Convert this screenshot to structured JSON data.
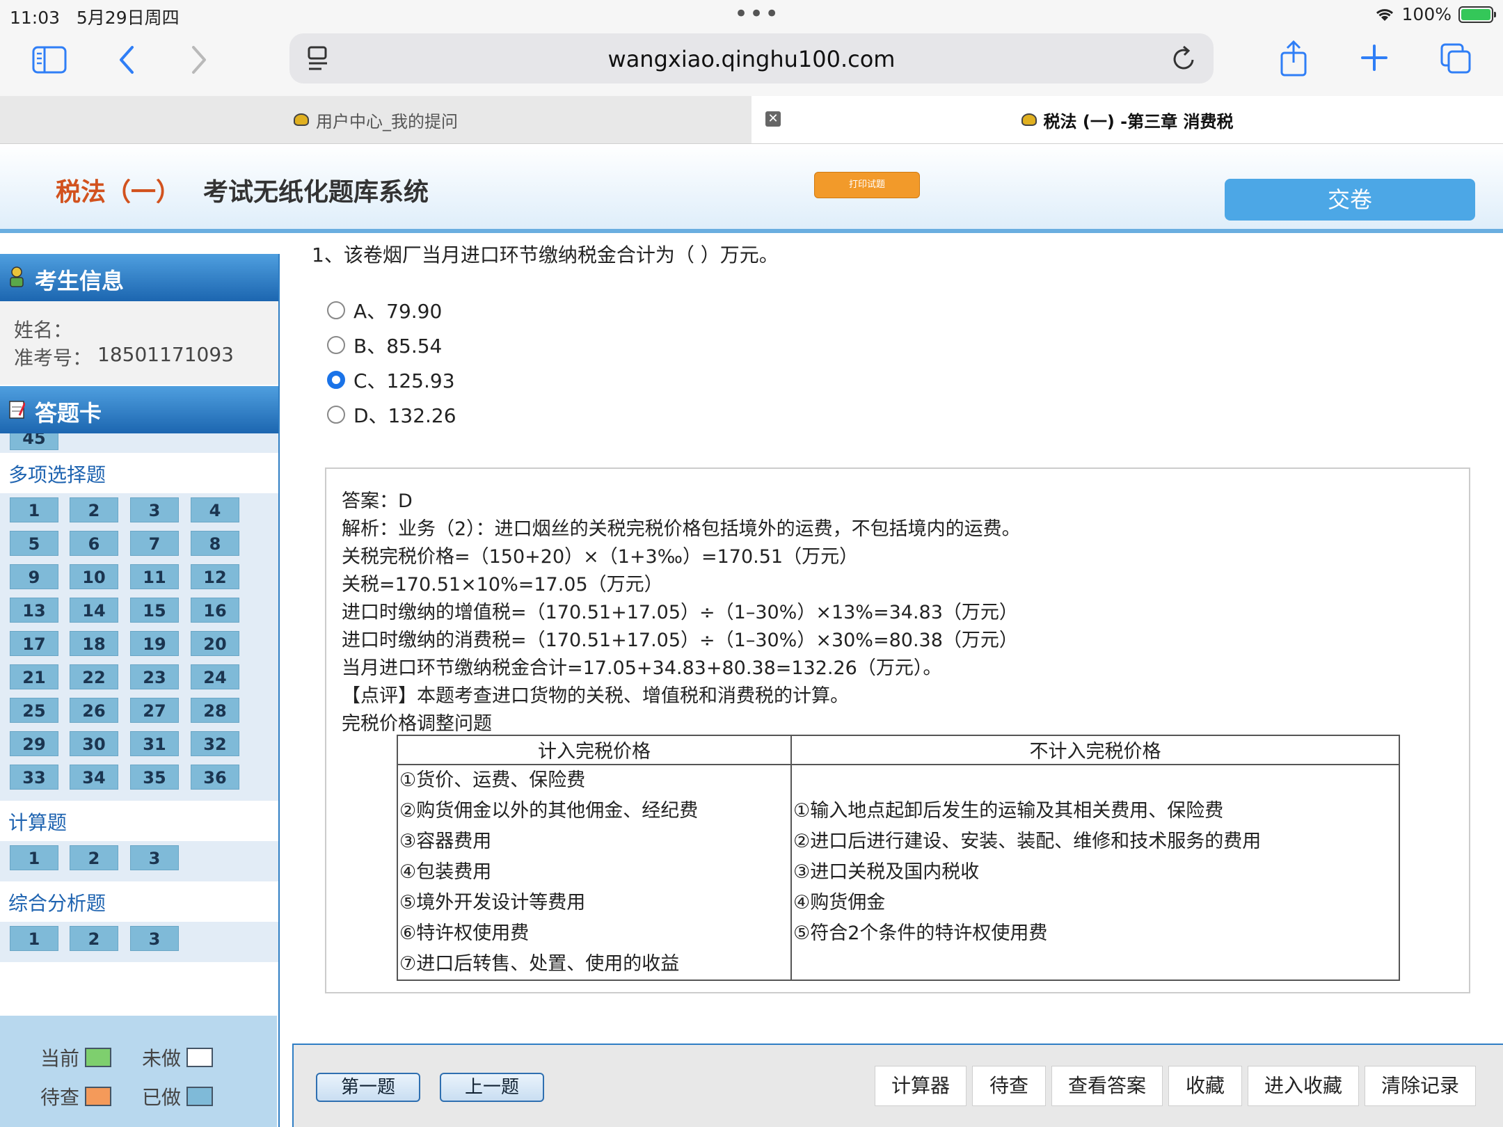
{
  "status": {
    "time": "11:03",
    "date": "5月29日周四",
    "battery": "100%"
  },
  "browser": {
    "url": "wangxiao.qinghu100.com",
    "tabs": [
      {
        "label": "用户中心_我的提问"
      },
      {
        "label": "税法 (一) -第三章 消费税"
      }
    ]
  },
  "header": {
    "subject": "税法（一）",
    "system": "考试无纸化题库系统",
    "print_label": "打印试题",
    "submit_label": "交卷"
  },
  "sidebar": {
    "info_title": "考生信息",
    "name_label": "姓名：",
    "id_label": "准考号：",
    "id_value": "18501171093",
    "card_title": "答题卡",
    "partial_cell": "45",
    "sections": [
      {
        "title": "多项选择题",
        "items": [
          "1",
          "2",
          "3",
          "4",
          "5",
          "6",
          "7",
          "8",
          "9",
          "10",
          "11",
          "12",
          "13",
          "14",
          "15",
          "16",
          "17",
          "18",
          "19",
          "20",
          "21",
          "22",
          "23",
          "24",
          "25",
          "26",
          "27",
          "28",
          "29",
          "30",
          "31",
          "32",
          "33",
          "34",
          "35",
          "36"
        ]
      },
      {
        "title": "计算题",
        "items": [
          "1",
          "2",
          "3"
        ]
      },
      {
        "title": "综合分析题",
        "items": [
          "1",
          "2",
          "3"
        ]
      }
    ],
    "legend": [
      {
        "label": "当前",
        "color": "#7ecf6e"
      },
      {
        "label": "未做",
        "color": "#ffffff"
      },
      {
        "label": "待查",
        "color": "#f49a5a"
      },
      {
        "label": "已做",
        "color": "#7fbad8"
      }
    ]
  },
  "question": {
    "text": "1、该卷烟厂当月进口环节缴纳税金合计为（   ）万元。",
    "options": [
      {
        "label": "A、79.90",
        "selected": false
      },
      {
        "label": "B、85.54",
        "selected": false
      },
      {
        "label": "C、125.93",
        "selected": true
      },
      {
        "label": "D、132.26",
        "selected": false
      }
    ]
  },
  "answer": {
    "lines": [
      "答案：D",
      "解析：业务（2）：进口烟丝的关税完税价格包括境外的运费，不包括境内的运费。",
      "关税完税价格=（150+20）×（1+3‰）=170.51（万元）",
      "关税=170.51×10%=17.05（万元）",
      "进口时缴纳的增值税=（170.51+17.05）÷（1–30%）×13%=34.83（万元）",
      "进口时缴纳的消费税=（170.51+17.05）÷（1–30%）×30%=80.38（万元）",
      "当月进口环节缴纳税金合计=17.05+34.83+80.38=132.26（万元）。",
      "【点评】本题考查进口货物的关税、增值税和消费税的计算。",
      "完税价格调整问题"
    ],
    "table": {
      "headers": [
        "计入完税价格",
        "不计入完税价格"
      ],
      "left": [
        "①货价、运费、保险费",
        "②购货佣金以外的其他佣金、经纪费",
        "③容器费用",
        "④包装费用",
        "⑤境外开发设计等费用",
        "⑥特许权使用费",
        "⑦进口后转售、处置、使用的收益"
      ],
      "right": [
        "",
        "①输入地点起卸后发生的运输及其相关费用、保险费",
        "②进口后进行建设、安装、装配、维修和技术服务的费用",
        "③进口关税及国内税收",
        "④购货佣金",
        "⑤符合2个条件的特许权使用费",
        ""
      ]
    }
  },
  "bottom": {
    "nav": [
      "第一题",
      "上一题"
    ],
    "actions": [
      "计算器",
      "待查",
      "查看答案",
      "收藏",
      "进入收藏",
      "清除记录"
    ]
  }
}
